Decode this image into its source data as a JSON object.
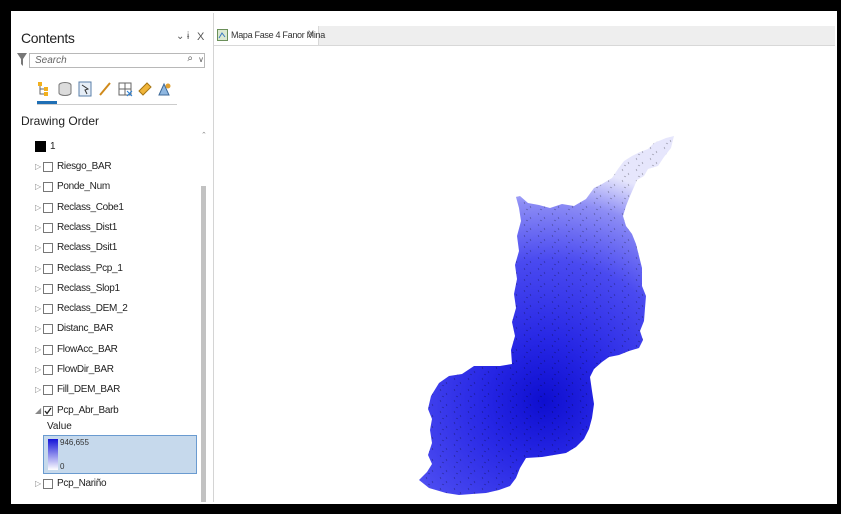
{
  "contents_pane": {
    "title": "Contents",
    "pin_glyph": "⌄",
    "autohide_glyph": "ɨ",
    "close_glyph": "X",
    "search_placeholder": "Search",
    "search_icon": "search-icon",
    "toolbar_icons": [
      "list-by-drawing-order-icon",
      "list-by-source-icon",
      "list-by-selection-icon",
      "list-by-editing-icon",
      "list-by-snapping-icon",
      "list-by-labeling-icon",
      "list-by-perspective-icon"
    ],
    "drawing_order_label": "Drawing Order",
    "map_root_label": "1",
    "layers": [
      {
        "label": "Riesgo_BAR",
        "checked": false
      },
      {
        "label": "Ponde_Num",
        "checked": false
      },
      {
        "label": "Reclass_Cobe1",
        "checked": false
      },
      {
        "label": "Reclass_Dist1",
        "checked": false
      },
      {
        "label": "Reclass_Dsit1",
        "checked": false
      },
      {
        "label": "Reclass_Pcp_1",
        "checked": false
      },
      {
        "label": "Reclass_Slop1",
        "checked": false
      },
      {
        "label": "Reclass_DEM_2",
        "checked": false
      },
      {
        "label": "Distanc_BAR",
        "checked": false
      },
      {
        "label": "FlowAcc_BAR",
        "checked": false
      },
      {
        "label": "FlowDir_BAR",
        "checked": false
      },
      {
        "label": "Fill_DEM_BAR",
        "checked": false
      },
      {
        "label": "Pcp_Abr_Barb",
        "checked": true,
        "expanded": true
      },
      {
        "label": "Pcp_Nariño",
        "checked": false
      }
    ],
    "legend": {
      "title": "Value",
      "max": "946,655",
      "min": "0",
      "color_high": "#1414d8",
      "color_low": "#ffffff"
    }
  },
  "map_tab": {
    "label": "Mapa Fase 4 Fanor Mina",
    "close_glyph": "X"
  },
  "colors": {
    "accent": "#1f6fb5",
    "raster_high": "#1212d6",
    "raster_mid": "#4a4af0",
    "raster_low": "#dcdcfb"
  }
}
